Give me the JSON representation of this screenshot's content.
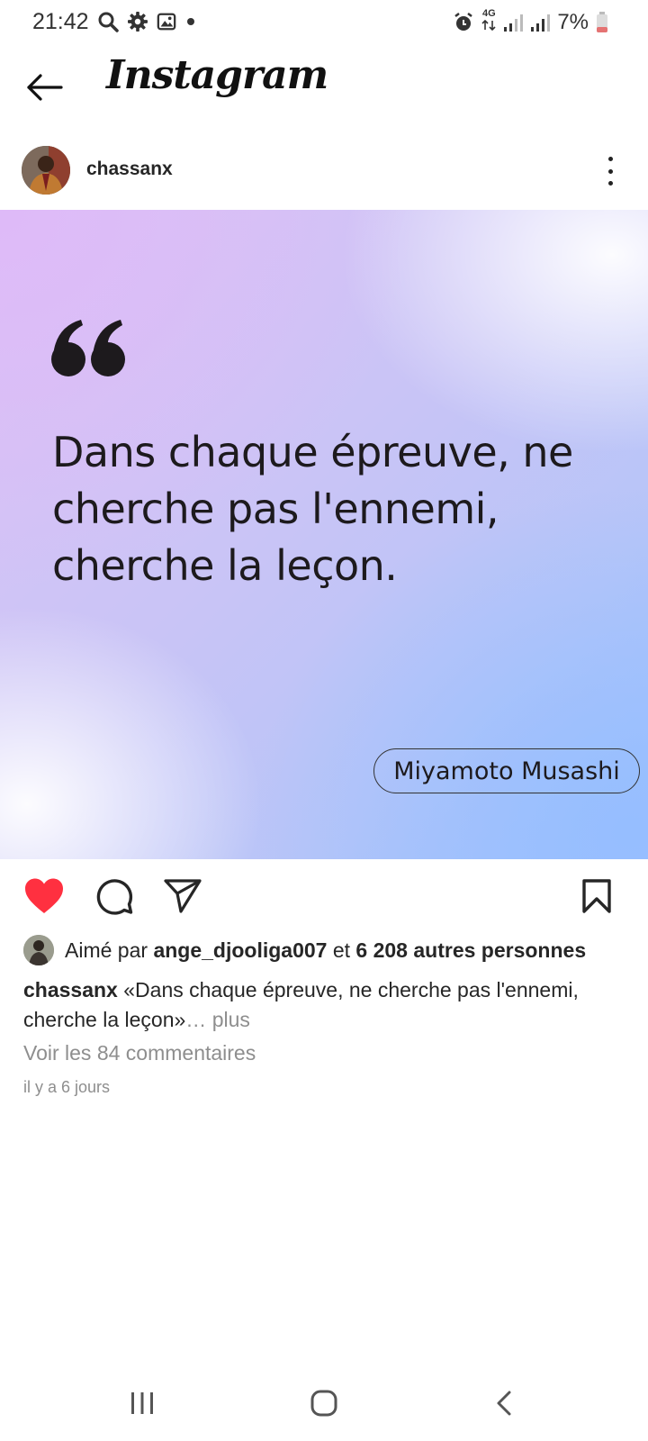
{
  "status_bar": {
    "time": "21:42",
    "network": "4G",
    "battery": "7%",
    "battery_color": "#e57373"
  },
  "header": {
    "app_name": "Instagram",
    "back_icon": "arrow-left-icon"
  },
  "post": {
    "username": "chassanx",
    "more_icon": "more-vertical-icon",
    "image": {
      "quote_lines": [
        "Dans chaque épreuve, ne",
        "cherche pas l'ennemi,",
        "cherche la leçon."
      ],
      "author": "Miyamoto Musashi"
    },
    "actions": {
      "like_icon": "heart-filled-icon",
      "like_color": "#ff3040",
      "comment_icon": "comment-icon",
      "share_icon": "send-icon",
      "save_icon": "bookmark-icon"
    },
    "likes": {
      "prefix": "Aimé par",
      "liker": "ange_djooliga007",
      "joiner": "et",
      "others": "6 208 autres personnes"
    },
    "caption": {
      "username": "chassanx",
      "text": "«Dans chaque épreuve, ne cherche pas l'ennemi, cherche la leçon»",
      "ellipsis": "…",
      "more_label": "plus"
    },
    "view_comments": "Voir les 84 commentaires",
    "timestamp": "il y a 6 jours"
  },
  "nav_bar": {
    "recents_icon": "recents-icon",
    "home_icon": "home-icon",
    "back_icon": "nav-back-icon"
  }
}
